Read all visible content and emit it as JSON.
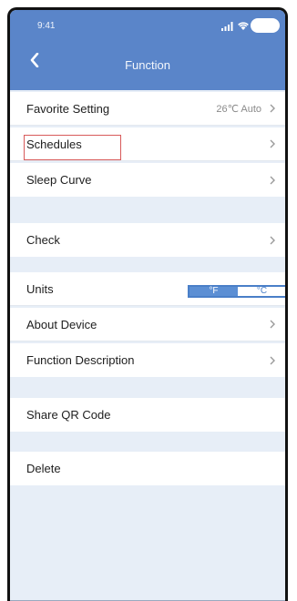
{
  "status_bar": {
    "time": "9:41",
    "signal_icon": "signal-bars-icon",
    "wifi_icon": "wifi-icon",
    "battery_icon": "battery-icon"
  },
  "nav": {
    "back_icon": "chevron-left-icon",
    "title": "Function"
  },
  "menu": {
    "favorite_setting": {
      "label": "Favorite Setting",
      "value": "26℃ Auto"
    },
    "schedules": {
      "label": "Schedules"
    },
    "sleep_curve": {
      "label": "Sleep Curve"
    },
    "check": {
      "label": "Check"
    },
    "units": {
      "label": "Units",
      "options": [
        "°F",
        "°C"
      ],
      "selected": "°F"
    },
    "about_device": {
      "label": "About Device"
    },
    "function_description": {
      "label": "Function Description"
    },
    "share_qr_code": {
      "label": "Share QR Code"
    },
    "delete": {
      "label": "Delete"
    }
  },
  "colors": {
    "header_blue": "#5a85c9",
    "background": "#e7eef7",
    "highlight_red": "#d85a5a",
    "toggle_blue": "#4a7fc8"
  }
}
